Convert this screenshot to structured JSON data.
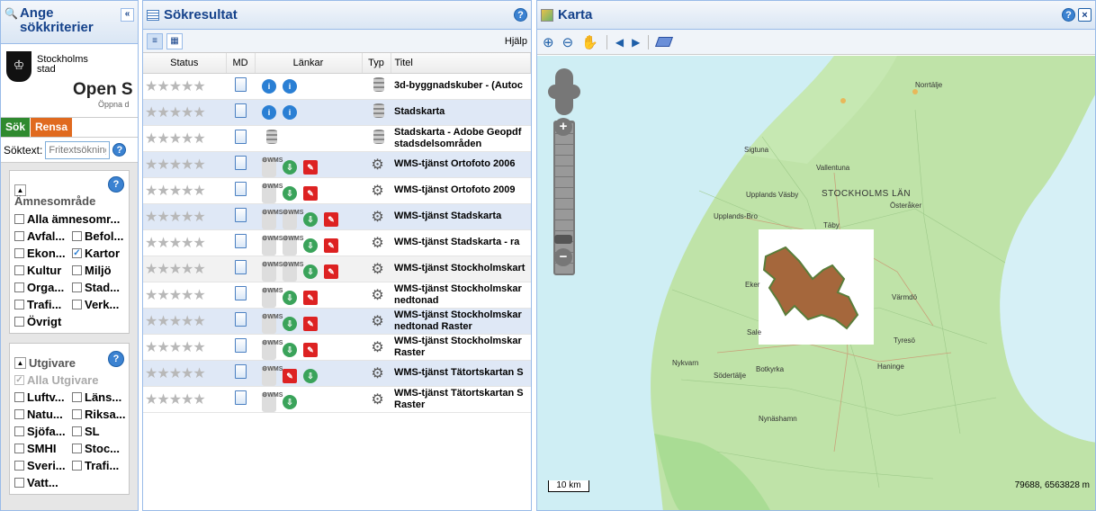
{
  "left": {
    "title_line1": "Ange",
    "title_line2": "sökkriterier",
    "logo_org_line1": "Stockholms",
    "logo_org_line2": "stad",
    "logo_open": "Open S",
    "logo_sub": "Öppna d",
    "btn_search": "Sök",
    "btn_clear": "Rensa",
    "search_label": "Söktext:",
    "search_placeholder": "Fritextsökning",
    "amne": {
      "title": "Ämnesområde",
      "all": "Alla ämnesomr...",
      "items": [
        {
          "label": "Avfal...",
          "checked": false
        },
        {
          "label": "Befol...",
          "checked": false
        },
        {
          "label": "Ekon...",
          "checked": false
        },
        {
          "label": "Kartor",
          "checked": true
        },
        {
          "label": "Kultur",
          "checked": false
        },
        {
          "label": "Miljö",
          "checked": false
        },
        {
          "label": "Orga...",
          "checked": false
        },
        {
          "label": "Stad...",
          "checked": false
        },
        {
          "label": "Trafi...",
          "checked": false
        },
        {
          "label": "Verk...",
          "checked": false
        }
      ],
      "last": "Övrigt"
    },
    "utg": {
      "title": "Utgivare",
      "all": "Alla Utgivare",
      "items": [
        {
          "label": "Luftv...",
          "checked": false
        },
        {
          "label": "Läns...",
          "checked": false
        },
        {
          "label": "Natu...",
          "checked": false
        },
        {
          "label": "Riksa...",
          "checked": false
        },
        {
          "label": "Sjöfa...",
          "checked": false
        },
        {
          "label": "SL",
          "checked": false
        },
        {
          "label": "SMHI",
          "checked": false
        },
        {
          "label": "Stoc...",
          "checked": false
        },
        {
          "label": "Sveri...",
          "checked": false
        },
        {
          "label": "Trafi...",
          "checked": false
        }
      ],
      "last": "Vatt..."
    }
  },
  "mid": {
    "title": "Sökresultat",
    "help_label": "Hjälp",
    "columns": {
      "status": "Status",
      "md": "MD",
      "links": "Länkar",
      "type": "Typ",
      "title": "Titel"
    },
    "rows": [
      {
        "links": [
          "q",
          "q"
        ],
        "type": "db",
        "title": "3d-byggnadskuber - (Autoc",
        "title2": ""
      },
      {
        "links": [
          "q",
          "q"
        ],
        "type": "db",
        "title": "Stadskarta",
        "title2": ""
      },
      {
        "links": [
          "dbadd"
        ],
        "type": "db",
        "title": "Stadskarta - Adobe Geopdf",
        "title2": "stadsdelsområden"
      },
      {
        "links": [
          "w",
          "g",
          "p"
        ],
        "type": "gear",
        "title": "WMS-tjänst Ortofoto 2006",
        "title2": ""
      },
      {
        "links": [
          "w",
          "g",
          "p"
        ],
        "type": "gear",
        "title": "WMS-tjänst Ortofoto 2009",
        "title2": ""
      },
      {
        "links": [
          "w",
          "w",
          "g",
          "p"
        ],
        "type": "gear",
        "title": "WMS-tjänst Stadskarta",
        "title2": ""
      },
      {
        "links": [
          "w",
          "w",
          "g",
          "p"
        ],
        "type": "gear",
        "title": "WMS-tjänst Stadskarta - ra",
        "title2": ""
      },
      {
        "links": [
          "w",
          "w",
          "g",
          "p"
        ],
        "type": "gear",
        "title": "WMS-tjänst Stockholmskart",
        "title2": ""
      },
      {
        "links": [
          "w",
          "g",
          "p"
        ],
        "type": "gear",
        "title": "WMS-tjänst Stockholmskar",
        "title2": "nedtonad"
      },
      {
        "links": [
          "w",
          "g",
          "p"
        ],
        "type": "gear",
        "title": "WMS-tjänst Stockholmskar",
        "title2": "nedtonad Raster"
      },
      {
        "links": [
          "w",
          "g",
          "p"
        ],
        "type": "gear",
        "title": "WMS-tjänst Stockholmskar",
        "title2": "Raster"
      },
      {
        "links": [
          "w",
          "p",
          "g"
        ],
        "type": "gear",
        "title": "WMS-tjänst Tätortskartan S",
        "title2": ""
      },
      {
        "links": [
          "w",
          "g"
        ],
        "type": "gear",
        "title": "WMS-tjänst Tätortskartan S",
        "title2": "Raster"
      }
    ]
  },
  "map": {
    "title": "Karta",
    "scale": "10 km",
    "coords": "79688, 6563828 m",
    "labels": [
      {
        "t": "Norrtälje"
      },
      {
        "t": "Sigtuna"
      },
      {
        "t": "Vallentuna"
      },
      {
        "t": "Upplands Väsby"
      },
      {
        "t": "STOCKHOLMS LÄN"
      },
      {
        "t": "Österåker"
      },
      {
        "t": "Upplands-Bro"
      },
      {
        "t": "Täby"
      },
      {
        "t": "Eker"
      },
      {
        "t": "Värmdö"
      },
      {
        "t": "Sale"
      },
      {
        "t": "Tyresö"
      },
      {
        "t": "Nykvarn"
      },
      {
        "t": "Södertälje"
      },
      {
        "t": "Botkyrka"
      },
      {
        "t": "Haninge"
      },
      {
        "t": "Nynäshamn"
      }
    ]
  }
}
